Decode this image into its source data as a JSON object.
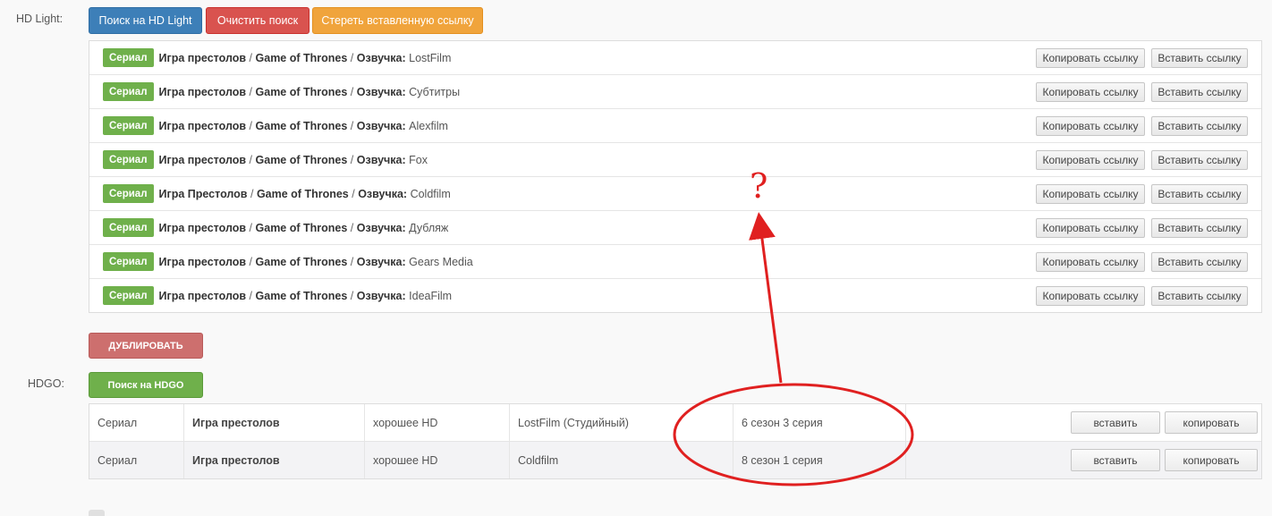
{
  "hdlight": {
    "label": "HD Light:",
    "search_button": "Поиск на HD Light",
    "clear_button": "Очистить поиск",
    "erase_button": "Стереть вставленную ссылку",
    "copy_label": "Копировать ссылку",
    "paste_label": "Вставить ссылку",
    "results": [
      {
        "tag": "Сериал",
        "title_ru": "Игра престолов",
        "title_en": "Game of Thrones",
        "voice_label": "Озвучка:",
        "voice": "LostFilm"
      },
      {
        "tag": "Сериал",
        "title_ru": "Игра престолов",
        "title_en": "Game of Thrones",
        "voice_label": "Озвучка:",
        "voice": "Субтитры"
      },
      {
        "tag": "Сериал",
        "title_ru": "Игра престолов",
        "title_en": "Game of Thrones",
        "voice_label": "Озвучка:",
        "voice": "Alexfilm"
      },
      {
        "tag": "Сериал",
        "title_ru": "Игра престолов",
        "title_en": "Game of Thrones",
        "voice_label": "Озвучка:",
        "voice": "Fox"
      },
      {
        "tag": "Сериал",
        "title_ru": "Игра Престолов",
        "title_en": "Game of Thrones",
        "voice_label": "Озвучка:",
        "voice": "Coldfilm"
      },
      {
        "tag": "Сериал",
        "title_ru": "Игра престолов",
        "title_en": "Game of Thrones",
        "voice_label": "Озвучка:",
        "voice": "Дубляж"
      },
      {
        "tag": "Сериал",
        "title_ru": "Игра престолов",
        "title_en": "Game of Thrones",
        "voice_label": "Озвучка:",
        "voice": "Gears Media"
      },
      {
        "tag": "Сериал",
        "title_ru": "Игра престолов",
        "title_en": "Game of Thrones",
        "voice_label": "Озвучка:",
        "voice": "IdeaFilm"
      }
    ]
  },
  "duplicate_button": "ДУБЛИРОВАТЬ",
  "hdgo": {
    "label": "HDGO:",
    "search_button": "Поиск на HDGO",
    "insert_label": "вставить",
    "copy_label": "копировать",
    "rows": [
      {
        "type": "Сериал",
        "title": "Игра престолов",
        "quality": "хорошее HD",
        "translation": "LostFilm (Студийный)",
        "episode": "6 сезон 3 серия"
      },
      {
        "type": "Сериал",
        "title": "Игра престолов",
        "quality": "хорошее HD",
        "translation": "Coldfilm",
        "episode": "8 сезон 1 серия"
      }
    ]
  },
  "annotation": {
    "mark": "?",
    "color": "#e02020"
  }
}
